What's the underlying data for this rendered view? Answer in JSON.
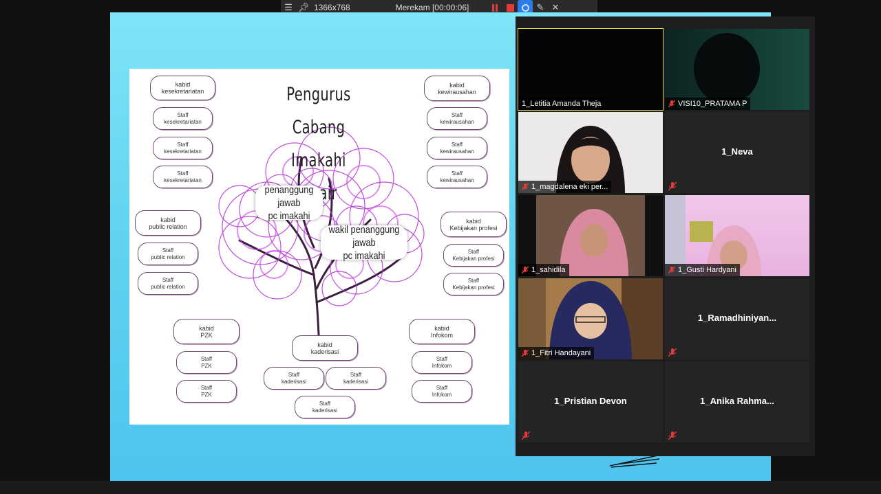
{
  "recorder": {
    "resolution": "1366x768",
    "status": "Merekam [00:00:06]",
    "colors": {
      "record": "#e23b3b",
      "camera": "#2d7be5"
    }
  },
  "slide": {
    "title_line1": "Pengurus Cabang",
    "title_line2": "Imakahi Unair",
    "bubbles": {
      "ketua": "penanggung jawab\npc imakahi",
      "wakil": "wakil penanggung jawab\npc imakahi"
    },
    "left": {
      "kesek_kabid": "kabid\nkesekretariatan",
      "kesek_staff": [
        "Staff\nkesekretariatan",
        "Staff\nkesekretariatan",
        "Staff\nkesekretariatan"
      ],
      "pr_kabid": "kabid\npublic relation",
      "pr_staff": [
        "Staff\npublic relation",
        "Staff\npublic relation"
      ],
      "pzk_kabid": "kabid\nPZK",
      "pzk_staff": [
        "Staff\nPZK",
        "Staff\nPZK"
      ]
    },
    "right": {
      "kwu_kabid": "kabid\nkewirausahan",
      "kwu_staff": [
        "Staff\nkewirausahan",
        "Staff\nkewirausahan",
        "Staff\nkewirausahan"
      ],
      "kp_kabid": "kabid\nKebijakan profesi",
      "kp_staff": [
        "Staff\nKebijakan profesi",
        "Staff\nKebijakan profesi"
      ],
      "infokom_kabid": "kabid\nInfokom",
      "infokom_staff": [
        "Staff\nInfokom",
        "Staff\nInfokom"
      ]
    },
    "center": {
      "kaderisasi_kabid": "kabid\nkaderisasi",
      "kaderisasi_staff": [
        "Staff\nkaderisasi",
        "Staff\nkaderisasi",
        "Staff\nkaderisasi"
      ]
    },
    "colors": {
      "tree": "#b52fd6",
      "background": "#62d4f0"
    }
  },
  "participants": [
    {
      "name": "1_Letitia Amanda Theja",
      "muted": false,
      "video": "dark",
      "active": true
    },
    {
      "name": "VISI10_PRATAMA P",
      "muted": true,
      "video": "silhouette"
    },
    {
      "name": "1_magdalena eki per...",
      "muted": true,
      "video": "person-hair"
    },
    {
      "name": "1_Neva",
      "muted": true,
      "video": "none"
    },
    {
      "name": "1_sahidila",
      "muted": true,
      "video": "person-hijab-pink"
    },
    {
      "name": "1_Gusti Hardyani",
      "muted": true,
      "video": "person-hijab-room"
    },
    {
      "name": "1_Fitri Handayani",
      "muted": true,
      "video": "person-hijab-navy"
    },
    {
      "name": "1_Ramadhiniyan...",
      "muted": true,
      "video": "none"
    },
    {
      "name": "1_Pristian Devon",
      "muted": true,
      "video": "none"
    },
    {
      "name": "1_Anika  Rahma...",
      "muted": true,
      "video": "none"
    }
  ]
}
